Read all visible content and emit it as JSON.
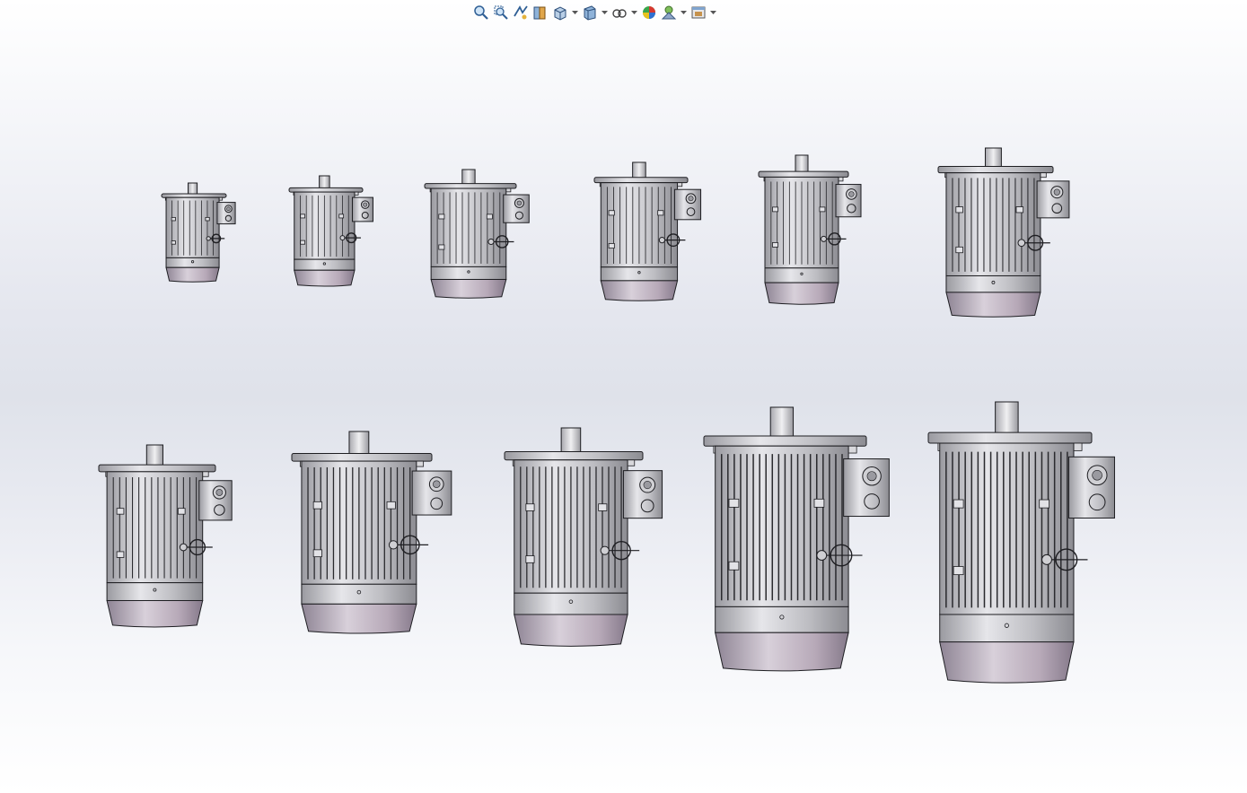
{
  "toolbar": {
    "buttons": [
      {
        "name": "zoom-to-fit-icon",
        "caret": false
      },
      {
        "name": "zoom-to-area-icon",
        "caret": false
      },
      {
        "name": "previous-view-icon",
        "caret": false
      },
      {
        "name": "section-view-icon",
        "caret": false
      },
      {
        "name": "view-orientation-icon",
        "caret": true
      },
      {
        "name": "display-style-icon",
        "caret": true
      },
      {
        "name": "hide-show-items-icon",
        "caret": true
      },
      {
        "name": "edit-appearance-icon",
        "caret": false
      },
      {
        "name": "apply-scene-icon",
        "caret": true
      },
      {
        "name": "view-settings-icon",
        "caret": true
      }
    ]
  },
  "motors": {
    "row1": {
      "count": 6
    },
    "row2": {
      "count": 5
    }
  },
  "colors": {
    "body": "#c4c4c8",
    "fin": "#2a2a2e",
    "base": "#b4a8b6",
    "outline": "#1e1e22"
  }
}
